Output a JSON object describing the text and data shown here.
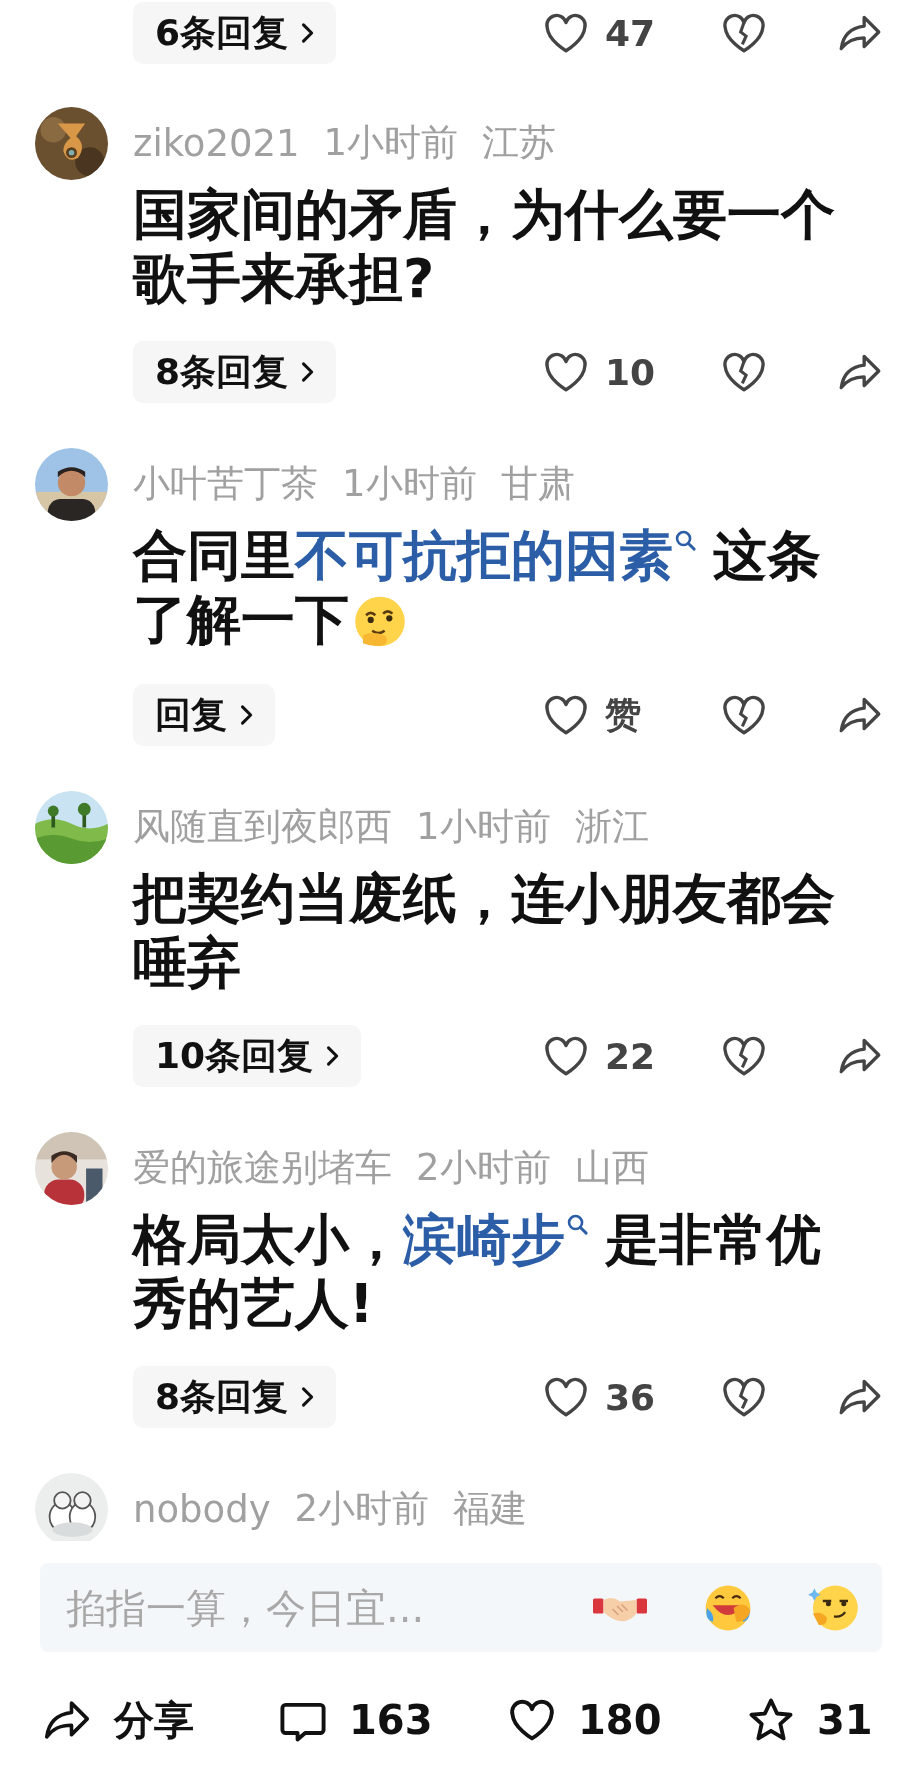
{
  "top_actions": {
    "replies": "6条回复",
    "likes": "47"
  },
  "comments": [
    {
      "user": "ziko2021",
      "time": "1小时前",
      "region": "江苏",
      "body": [
        {
          "kind": "text",
          "text": "国家间的矛盾，为什么要一个歌手来承担?"
        }
      ],
      "replies": "8条回复",
      "likes": "10"
    },
    {
      "user": "小叶苦丁茶",
      "time": "1小时前",
      "region": "甘肃",
      "body": [
        {
          "kind": "text",
          "text": "合同里"
        },
        {
          "kind": "link",
          "text": "不可抗拒的因素"
        },
        {
          "kind": "text",
          "text": "这条了解一下"
        },
        {
          "kind": "emoji"
        }
      ],
      "replies": "回复",
      "likes": "赞"
    },
    {
      "user": "风随直到夜郎西",
      "time": "1小时前",
      "region": "浙江",
      "body": [
        {
          "kind": "text",
          "text": "把契约当废纸，连小朋友都会唾弃"
        }
      ],
      "replies": "10条回复",
      "likes": "22"
    },
    {
      "user": "爱的旅途别堵车",
      "time": "2小时前",
      "region": "山西",
      "body": [
        {
          "kind": "text",
          "text": "格局太小，"
        },
        {
          "kind": "link",
          "text": "滨崎步"
        },
        {
          "kind": "text",
          "text": "是非常优秀的艺人!"
        }
      ],
      "replies": "8条回复",
      "likes": "36"
    },
    {
      "user": "nobody",
      "time": "2小时前",
      "region": "福建"
    }
  ],
  "input": {
    "placeholder": "掐指一算，今日宜..."
  },
  "bottom_bar": {
    "share": "分享",
    "comments": "163",
    "likes": "180",
    "favorites": "31"
  }
}
